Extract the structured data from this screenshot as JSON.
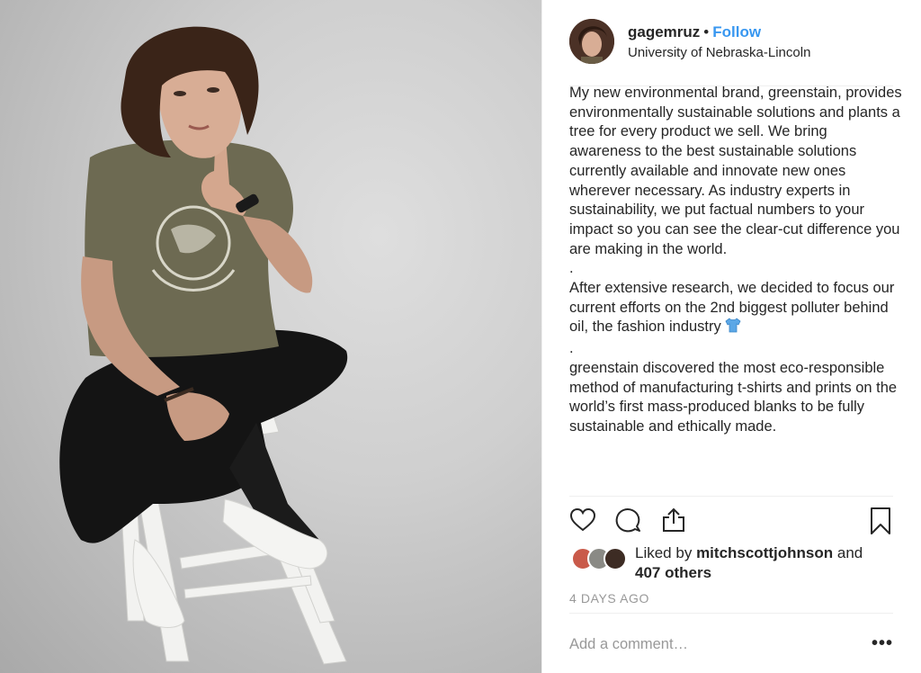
{
  "post": {
    "username": "gagemruz",
    "separator": "•",
    "follow_label": "Follow",
    "location": "University of Nebraska-Lincoln"
  },
  "caption": {
    "para1": "My new environmental brand, greenstain, provides environmentally sustainable solutions and plants a tree for every product we sell. We bring awareness to the best sustainable solutions currently available and innovate new ones wherever necessary. As industry experts in sustainability, we put factual numbers to your impact so you can see the clear-cut difference you are making in the world.",
    "dot1": ".",
    "para2": "After extensive research, we decided to focus our current efforts on the 2nd biggest polluter behind oil, the fashion industry",
    "dot2": ".",
    "para3": "greenstain discovered the most eco-responsible method of manufacturing t-shirts and prints on the world’s first mass-produced blanks to be fully sustainable and ethically made."
  },
  "actions": {
    "like_icon": "heart-icon",
    "comment_icon": "comment-icon",
    "share_icon": "share-icon",
    "save_icon": "bookmark-icon"
  },
  "likes": {
    "prefix": "Liked by",
    "user": "mitchscottjohnson",
    "and": "and",
    "others": "407 others"
  },
  "timestamp": "4 DAYS AGO",
  "comment": {
    "placeholder": "Add a comment…",
    "more_label": "•••"
  },
  "colors": {
    "link": "#3897f0",
    "text": "#262626",
    "muted": "#999999",
    "divider": "#efefef"
  }
}
